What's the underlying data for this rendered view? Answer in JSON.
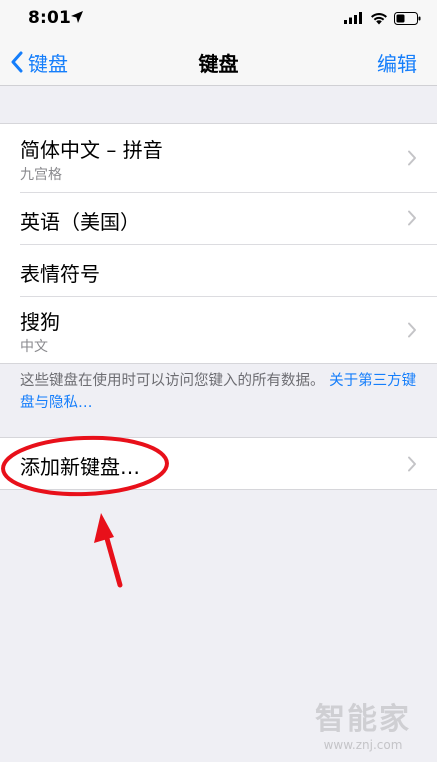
{
  "status_bar": {
    "time": "8:01"
  },
  "nav": {
    "back_label": "键盘",
    "title": "键盘",
    "edit_label": "编辑"
  },
  "keyboards": [
    {
      "title": "简体中文 – 拼音",
      "subtitle": "九宫格"
    },
    {
      "title": "英语（美国）",
      "subtitle": ""
    },
    {
      "title": "表情符号",
      "subtitle": ""
    },
    {
      "title": "搜狗",
      "subtitle": "中文"
    }
  ],
  "footer": {
    "note": "这些键盘在使用时可以访问您键入的所有数据。",
    "link": "关于第三方键盘与隐私…"
  },
  "add_keyboard": {
    "label": "添加新键盘…"
  },
  "watermark": {
    "brand": "智能家",
    "url": "www.znj.com"
  },
  "colors": {
    "accent": "#157efb",
    "annotation": "#e8101a",
    "background": "#efeff4"
  }
}
